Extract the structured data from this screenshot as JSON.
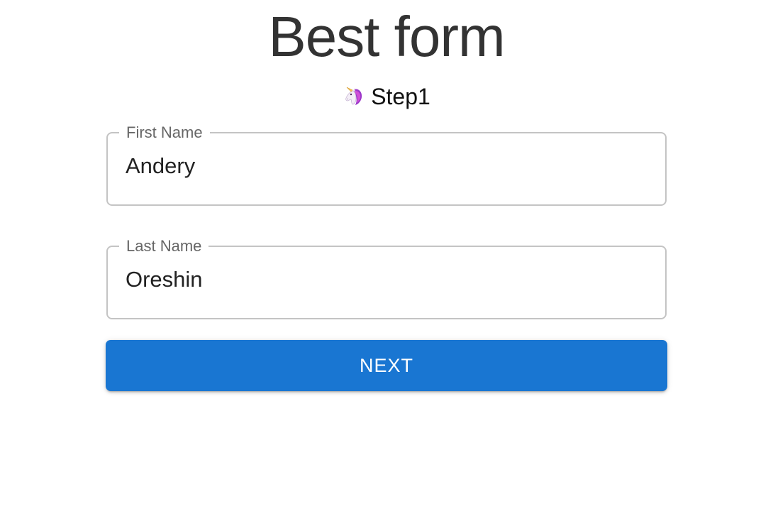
{
  "header": {
    "title": "Best form"
  },
  "step": {
    "icon": "unicorn-icon",
    "label": "Step1"
  },
  "form": {
    "first_name": {
      "label": "First Name",
      "value": "Andery"
    },
    "last_name": {
      "label": "Last Name",
      "value": "Oreshin"
    }
  },
  "actions": {
    "next_label": "NEXT"
  },
  "colors": {
    "accent": "#1976d2",
    "title": "#333333",
    "border": "#c4c4c4",
    "label": "#666666"
  }
}
